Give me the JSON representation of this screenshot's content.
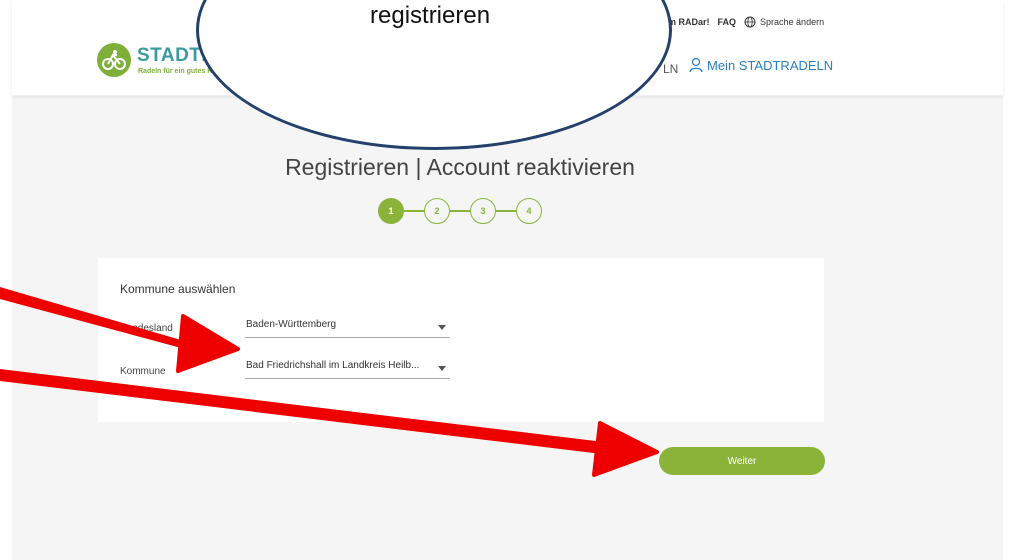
{
  "callout": {
    "text": "registrieren"
  },
  "header": {
    "logo_title": "STADTR",
    "logo_sub": "Radeln für ein gutes K",
    "top_links": {
      "radar": "m RADar!",
      "faq": "FAQ",
      "language": "Sprache ändern"
    },
    "nav_partial": "LN",
    "account_link": "Mein STADTRADELN"
  },
  "main": {
    "heading": "Registrieren  |  Account reaktivieren",
    "steps": [
      "1",
      "2",
      "3",
      "4"
    ],
    "active_step": 1
  },
  "card": {
    "title": "Kommune auswählen",
    "state_label": "Bundesland",
    "state_value": "Baden-Württemberg",
    "municipality_label": "Kommune",
    "municipality_value": "Bad Friedrichshall im Landkreis Heilb..."
  },
  "actions": {
    "next_label": "Weiter"
  },
  "colors": {
    "brand_green": "#8bb33a",
    "brand_teal": "#3a9a9e",
    "link_blue": "#2a7fc2",
    "annotation_red": "#ee0000",
    "callout_border": "#24406c"
  }
}
